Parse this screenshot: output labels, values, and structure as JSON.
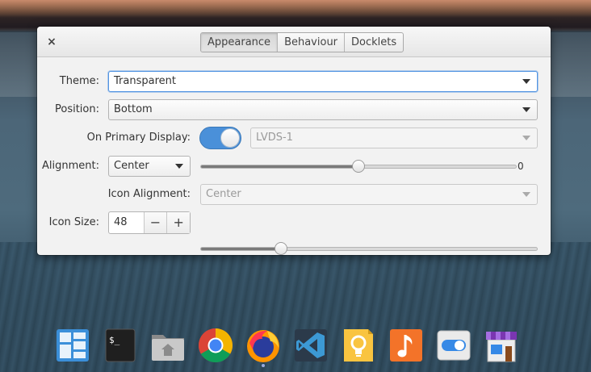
{
  "window": {
    "close_glyph": "×",
    "tabs": [
      {
        "label": "Appearance",
        "active": true
      },
      {
        "label": "Behaviour",
        "active": false
      },
      {
        "label": "Docklets",
        "active": false
      }
    ]
  },
  "settings": {
    "theme": {
      "label": "Theme:",
      "value": "Transparent"
    },
    "position": {
      "label": "Position:",
      "value": "Bottom"
    },
    "primary_display": {
      "label": "On Primary Display:",
      "enabled": true,
      "monitor_value": "LVDS-1"
    },
    "alignment": {
      "label": "Alignment:",
      "value": "Center",
      "offset_value": "0",
      "offset_fraction": 0.5
    },
    "icon_alignment": {
      "label": "Icon Alignment:",
      "value": "Center"
    },
    "icon_size": {
      "label": "Icon Size:",
      "value": "48",
      "decrement": "−",
      "increment": "+",
      "slider_fraction": 0.24
    }
  },
  "dock": {
    "icons": [
      {
        "name": "multitasking-view-icon",
        "running": false
      },
      {
        "name": "terminal-icon",
        "label": "$_",
        "running": false
      },
      {
        "name": "files-icon",
        "running": false
      },
      {
        "name": "chrome-icon",
        "running": false
      },
      {
        "name": "firefox-icon",
        "running": true
      },
      {
        "name": "vscode-icon",
        "running": false
      },
      {
        "name": "ideas-icon",
        "running": false
      },
      {
        "name": "music-icon",
        "running": false
      },
      {
        "name": "settings-toggle-icon",
        "running": false
      },
      {
        "name": "appcenter-icon",
        "running": false
      }
    ]
  },
  "colors": {
    "accent": "#4a90d9",
    "focus": "#5294e2"
  }
}
